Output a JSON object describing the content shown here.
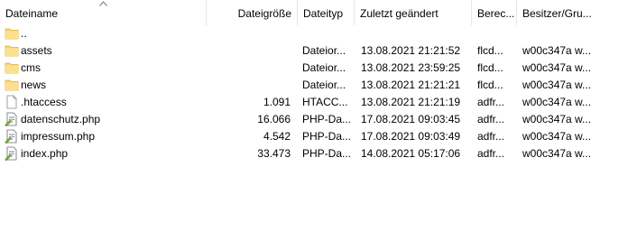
{
  "columns": {
    "name": "Dateiname",
    "size": "Dateigröße",
    "type": "Dateityp",
    "modified": "Zuletzt geändert",
    "permissions": "Berec...",
    "owner": "Besitzer/Gru..."
  },
  "rows": [
    {
      "name": "..",
      "size": "",
      "type": "",
      "modified": "",
      "permissions": "",
      "owner": "",
      "icon": "folder-icon"
    },
    {
      "name": "assets",
      "size": "",
      "type": "Dateior...",
      "modified": "13.08.2021 21:21:52",
      "permissions": "flcd...",
      "owner": "w00c347a w...",
      "icon": "folder-icon"
    },
    {
      "name": "cms",
      "size": "",
      "type": "Dateior...",
      "modified": "13.08.2021 23:59:25",
      "permissions": "flcd...",
      "owner": "w00c347a w...",
      "icon": "folder-icon"
    },
    {
      "name": "news",
      "size": "",
      "type": "Dateior...",
      "modified": "13.08.2021 21:21:21",
      "permissions": "flcd...",
      "owner": "w00c347a w...",
      "icon": "folder-icon"
    },
    {
      "name": ".htaccess",
      "size": "1.091",
      "type": "HTACC...",
      "modified": "13.08.2021 21:21:19",
      "permissions": "adfr...",
      "owner": "w00c347a w...",
      "icon": "blank-file-icon"
    },
    {
      "name": "datenschutz.php",
      "size": "16.066",
      "type": "PHP-Da...",
      "modified": "17.08.2021 09:03:45",
      "permissions": "adfr...",
      "owner": "w00c347a w...",
      "icon": "php-file-icon"
    },
    {
      "name": "impressum.php",
      "size": "4.542",
      "type": "PHP-Da...",
      "modified": "17.08.2021 09:03:49",
      "permissions": "adfr...",
      "owner": "w00c347a w...",
      "icon": "php-file-icon"
    },
    {
      "name": "index.php",
      "size": "33.473",
      "type": "PHP-Da...",
      "modified": "14.08.2021 05:17:06",
      "permissions": "adfr...",
      "owner": "w00c347a w...",
      "icon": "php-file-icon"
    }
  ],
  "colors": {
    "folder": "#f8d775",
    "folder_dark": "#e0b03a",
    "header_divider": "#e5e5e5"
  }
}
